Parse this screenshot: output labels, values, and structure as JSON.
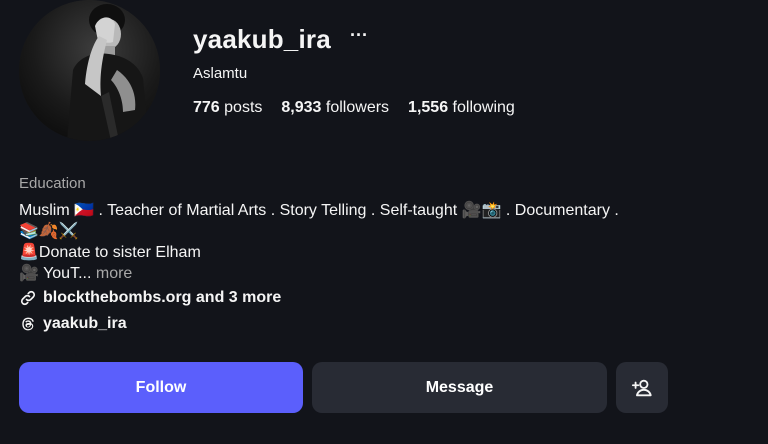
{
  "profile": {
    "username": "yaakub_ira",
    "more_label": "···",
    "full_name": "Aslamtu",
    "stats": {
      "posts_count": "776",
      "posts_label": "posts",
      "followers_count": "8,933",
      "followers_label": "followers",
      "following_count": "1,556",
      "following_label": "following"
    },
    "category": "Education",
    "bio": {
      "line1": "Muslim 🇵🇭 . Teacher of Martial Arts . Story Telling . Self-taught 🎥📸 . Documentary .",
      "line2": "📚🍂⚔️",
      "line3": "🚨Donate to sister Elham",
      "line4_text": "🎥 YouT...",
      "more_label": "more"
    },
    "link_text": "blockthebombs.org and 3 more",
    "threads_handle": "yaakub_ira"
  },
  "actions": {
    "follow_label": "Follow",
    "message_label": "Message"
  },
  "icons": {
    "more": "more-options-icon",
    "link": "link-icon",
    "threads": "threads-icon",
    "add_person": "add-person-icon"
  },
  "colors": {
    "background": "#12141a",
    "follow_button": "#5b5ffc",
    "secondary_button": "#282b34",
    "muted_text": "#a8a8a8"
  }
}
